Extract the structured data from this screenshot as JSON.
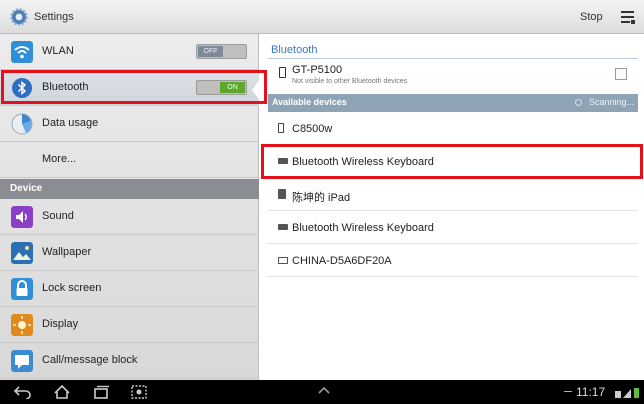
{
  "actionbar": {
    "title": "Settings",
    "icon": "settings-gear-icon",
    "stop_label": "Stop",
    "menu_icon": "overflow-menu-icon"
  },
  "sidebar": {
    "items": [
      {
        "label": "WLAN",
        "icon": "wifi-icon",
        "toggle": "OFF"
      },
      {
        "label": "Bluetooth",
        "icon": "bluetooth-icon",
        "toggle": "ON",
        "selected": true
      },
      {
        "label": "Data usage",
        "icon": "data-usage-icon"
      },
      {
        "label": "More...",
        "icon": ""
      }
    ],
    "section_device": "Device",
    "device_items": [
      {
        "label": "Sound",
        "icon": "sound-icon"
      },
      {
        "label": "Wallpaper",
        "icon": "wallpaper-icon"
      },
      {
        "label": "Lock screen",
        "icon": "lock-icon"
      },
      {
        "label": "Display",
        "icon": "display-icon"
      },
      {
        "label": "Call/message block",
        "icon": "call-block-icon"
      }
    ]
  },
  "bluetooth": {
    "header": "Bluetooth",
    "this_device": {
      "name": "GT-P5100",
      "subtitle": "Not visible to other Bluetooth devices",
      "visible_checked": false
    },
    "available_header": "Available devices",
    "scanning_label": "Scanning...",
    "devices": [
      {
        "name": "C8500w",
        "icon": "phone-icon"
      },
      {
        "name": "Bluetooth Wireless Keyboard",
        "icon": "keyboard-icon",
        "highlighted": true
      },
      {
        "name": "陈坤的 iPad",
        "icon": "tablet-icon"
      },
      {
        "name": "Bluetooth Wireless Keyboard",
        "icon": "keyboard-icon"
      },
      {
        "name": "CHINA-D5A6DF20A",
        "icon": "computer-icon"
      }
    ]
  },
  "navbar": {
    "time": "11:17"
  },
  "colors": {
    "accent": "#3a79b8",
    "highlight": "#e5101a",
    "toggle_on": "#5aa92d",
    "toggle_off": "#7f8a99"
  }
}
